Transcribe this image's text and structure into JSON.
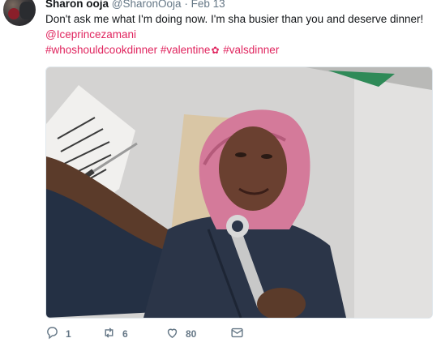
{
  "tweet": {
    "author_name": "Sharon ooja",
    "author_handle": "@SharonOoja",
    "separator": "·",
    "timestamp": "Feb 13",
    "text": "Don't ask me what I'm doing now. I'm sha busier than you and deserve dinner!",
    "mention": "@Iceprincezamani",
    "hashtag_1": "#whoshouldcookdinner",
    "hashtag_2": "#valentine",
    "hashtag_3": "#valsdinner",
    "emoji": "rose-emoji"
  },
  "actions": {
    "replies": "1",
    "retweets": "6",
    "likes": "80"
  },
  "icons": [
    "reply-icon",
    "retweet-icon",
    "like-icon",
    "direct-message-icon"
  ],
  "colors": {
    "link": "#e0245e",
    "secondary_text": "#657786",
    "primary_text": "#14171a"
  }
}
